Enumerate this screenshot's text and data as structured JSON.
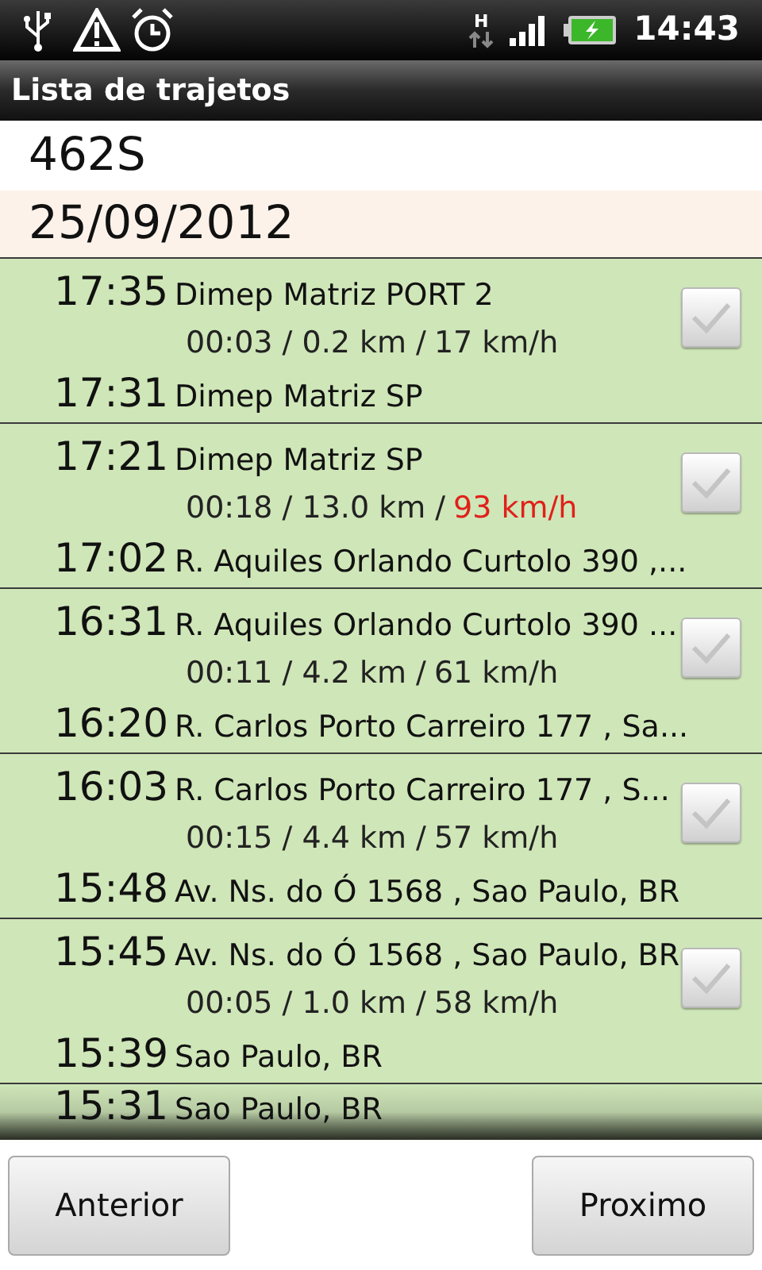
{
  "status_bar": {
    "network": "H",
    "time": "14:43"
  },
  "title": "Lista de trajetos",
  "vehicle": "462S",
  "date": "25/09/2012",
  "trips": [
    {
      "start_time": "17:35",
      "start_place": "Dimep Matriz PORT 2",
      "stats": "00:03 / 0.2 km /",
      "speed": "17 km/h",
      "speeding": false,
      "end_time": "17:31",
      "end_place": "Dimep Matriz SP",
      "checked": false
    },
    {
      "start_time": "17:21",
      "start_place": "Dimep Matriz SP",
      "stats": "00:18 / 13.0 km /",
      "speed": "93 km/h",
      "speeding": true,
      "end_time": "17:02",
      "end_place": "R. Aquiles Orlando Curtolo 390 ,...",
      "checked": false
    },
    {
      "start_time": "16:31",
      "start_place": "R. Aquiles Orlando Curtolo 390 ...",
      "stats": "00:11 / 4.2 km /",
      "speed": "61 km/h",
      "speeding": false,
      "end_time": "16:20",
      "end_place": "R. Carlos Porto Carreiro 177 , Sa...",
      "checked": false
    },
    {
      "start_time": "16:03",
      "start_place": "R. Carlos Porto Carreiro 177 , S...",
      "stats": "00:15 / 4.4 km /",
      "speed": "57 km/h",
      "speeding": false,
      "end_time": "15:48",
      "end_place": "Av. Ns. do Ó 1568 , Sao Paulo, BR",
      "checked": false
    },
    {
      "start_time": "15:45",
      "start_place": "Av. Ns. do Ó 1568 , Sao Paulo, BR",
      "stats": "00:05 / 1.0 km /",
      "speed": "58 km/h",
      "speeding": false,
      "end_time": "15:39",
      "end_place": "Sao Paulo, BR",
      "checked": false
    },
    {
      "start_time": "15:31",
      "start_place": "Sao Paulo, BR",
      "partial": true
    }
  ],
  "buttons": [
    "Anterior",
    "Proximo"
  ]
}
